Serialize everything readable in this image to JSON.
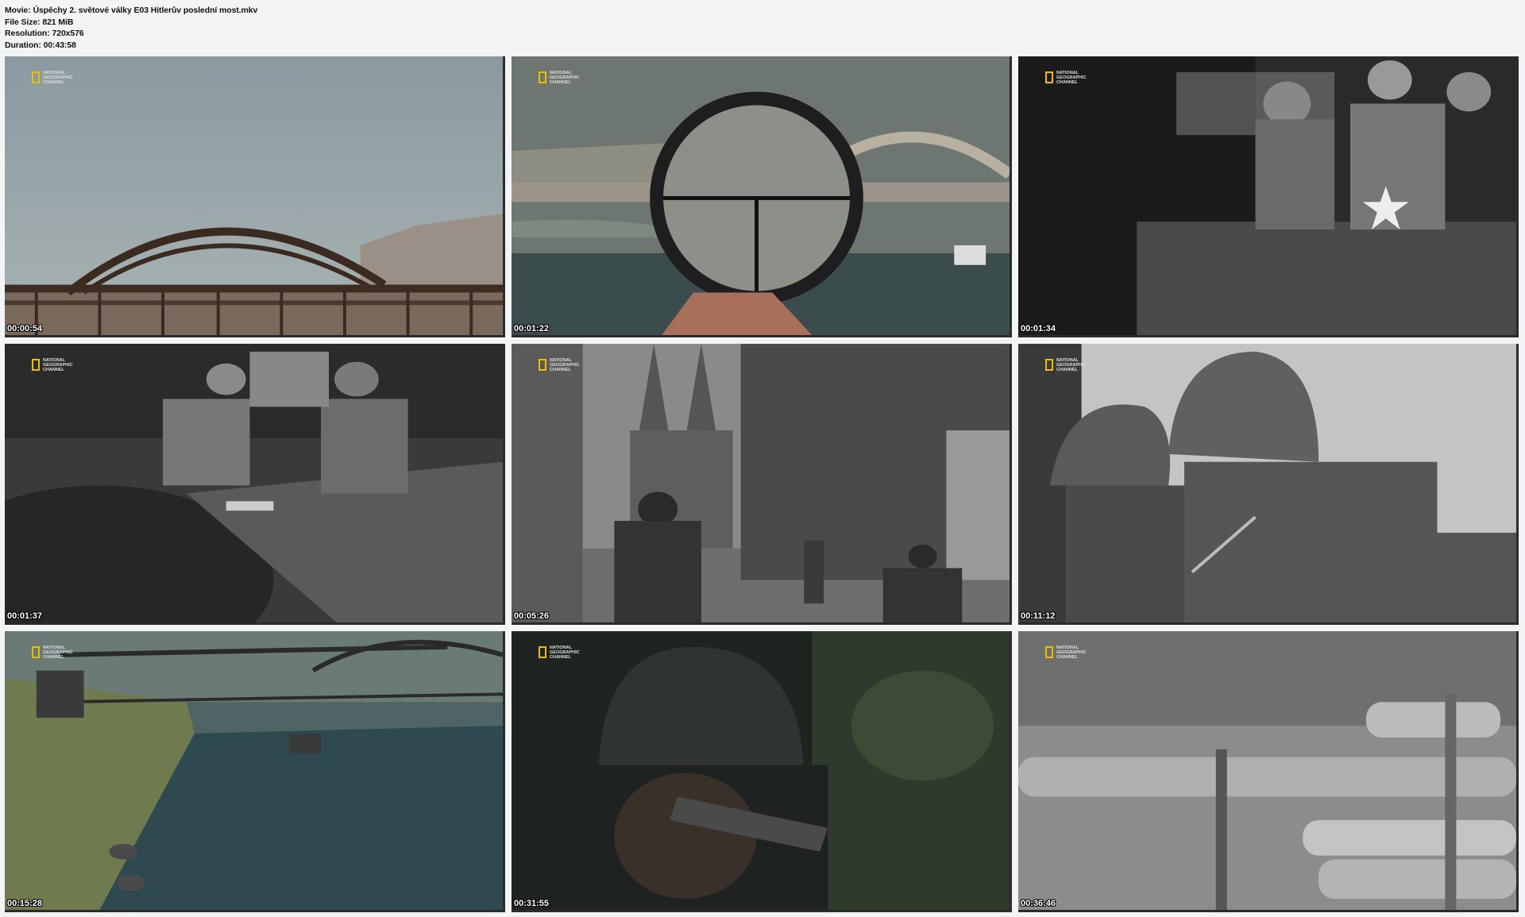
{
  "info": {
    "movie": "Movie: Úspěchy 2. světové války E03 Hitlerův poslední most.mkv",
    "file_size": "File Size: 821 MiB",
    "resolution": "Resolution: 720x576",
    "duration": "Duration: 00:43:58"
  },
  "logo_text": "NATIONAL\nGEOGRAPHIC\nCHANNEL",
  "colors": {
    "logo_yellow": "#e8c000",
    "background": "#f3f4f6"
  },
  "thumbnails": [
    {
      "timestamp": "00:00:54",
      "scene": "bridge-color"
    },
    {
      "timestamp": "00:01:22",
      "scene": "scope-bridge"
    },
    {
      "timestamp": "00:01:34",
      "scene": "tank-soldiers"
    },
    {
      "timestamp": "00:01:37",
      "scene": "soldiers-truck"
    },
    {
      "timestamp": "00:05:26",
      "scene": "street-cathedral"
    },
    {
      "timestamp": "00:11:12",
      "scene": "german-soldiers"
    },
    {
      "timestamp": "00:15:28",
      "scene": "cg-bridge-river"
    },
    {
      "timestamp": "00:31:55",
      "scene": "soldier-aiming"
    },
    {
      "timestamp": "00:36:46",
      "scene": "artillery-gun"
    }
  ]
}
